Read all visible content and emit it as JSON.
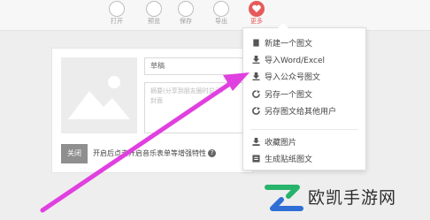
{
  "toolbar": {
    "items": [
      {
        "label": "打开",
        "icon": "folder-open-icon"
      },
      {
        "label": "预览",
        "icon": "eye-icon"
      },
      {
        "label": "保存",
        "icon": "save-icon"
      },
      {
        "label": "导出",
        "icon": "export-icon"
      },
      {
        "label": "更多",
        "icon": "heart-icon"
      }
    ]
  },
  "editor": {
    "title_value": "草稿",
    "summary_placeholder": "摘要(分享到朋友圈时显示)",
    "summary_line2": "封面",
    "close_label": "关闭",
    "hint_text": "开启后点击开启音乐表单等增强特性",
    "hint_icon": "?"
  },
  "menu": {
    "items": [
      {
        "label": "新建一个图文",
        "icon": "new-doc-icon"
      },
      {
        "label": "导入Word/Excel",
        "icon": "import-icon"
      },
      {
        "label": "导入公众号图文",
        "icon": "import-icon"
      },
      {
        "label": "另存一个图文",
        "icon": "save-as-icon"
      },
      {
        "label": "另存图文给其他用户",
        "icon": "save-as-icon"
      },
      {
        "label": "收藏图片",
        "icon": "collect-image-icon"
      },
      {
        "label": "生成贴纸图文",
        "icon": "sticker-icon"
      }
    ]
  },
  "watermark": {
    "text": "欧凯手游网"
  },
  "colors": {
    "accent": "#e65a5a",
    "arrow": "#e040e0",
    "logo_green": "#27b36b",
    "logo_blue": "#2f6fd6"
  }
}
